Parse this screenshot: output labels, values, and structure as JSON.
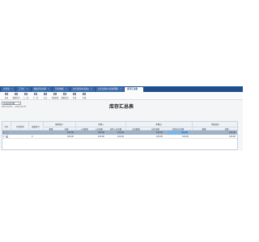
{
  "tabs": [
    {
      "label": "业务组",
      "active": false
    },
    {
      "label": "工具栏",
      "active": false
    },
    {
      "label": "数据库使用率",
      "active": false
    },
    {
      "label": "同步数据",
      "active": false
    },
    {
      "label": "业务表维护(表格)",
      "active": false
    },
    {
      "label": "业务表维护(表格明细)",
      "active": false
    },
    {
      "label": "库存汇总表",
      "active": true
    }
  ],
  "toolbar": [
    {
      "label": "退出",
      "icon": "exit-icon"
    },
    {
      "label": "数据时间",
      "icon": "clock-icon"
    },
    {
      "label": "上一页",
      "icon": "prev-icon"
    },
    {
      "label": "下一页",
      "icon": "next-icon"
    },
    {
      "label": "汇总",
      "icon": "sum-icon"
    },
    {
      "label": "列表配置",
      "icon": "list-config-icon"
    },
    {
      "label": "数据查询",
      "icon": "query-icon"
    },
    {
      "label": "导出",
      "icon": "export-icon"
    },
    {
      "label": "关闭",
      "icon": "close-icon"
    }
  ],
  "filter": {
    "select_value": "可发运库存数",
    "date_range": "2022-09-01 ~ 2022-09-30"
  },
  "report_title": "库存汇总表",
  "grid": {
    "fixed_headers": [
      "序号",
      "存货名称",
      "规格型号"
    ],
    "groups": [
      {
        "label": "期初结存",
        "sub": [
          "数量",
          "金额"
        ]
      },
      {
        "label": "本期入",
        "sub": [
          "入库数量",
          "入库金额",
          "其他入库金额"
        ]
      },
      {
        "label": "本期出",
        "sub": [
          "出库数量",
          "出库金额",
          "其他出库金额"
        ]
      },
      {
        "label": "期末结存",
        "sub": [
          "数量",
          "金额"
        ]
      }
    ],
    "rows": [
      {
        "no": "1",
        "name": "",
        "spec": "",
        "values": [
          "",
          "100.00",
          "",
          "100.00",
          "100.00",
          "",
          "100.00",
          "100.00",
          "",
          "100.00"
        ],
        "selected": true
      },
      {
        "no": "2",
        "name": "",
        "spec": "0",
        "values": [
          "",
          "100.00",
          "",
          "100.00",
          "100.00",
          "",
          "100.00",
          "100.00",
          "",
          "100.00"
        ],
        "selected": false
      }
    ]
  },
  "colors": {
    "tabbar": "#1f4e8c",
    "selected_row": "#9fb2c8",
    "edit_cell": "#7fb4e6"
  }
}
